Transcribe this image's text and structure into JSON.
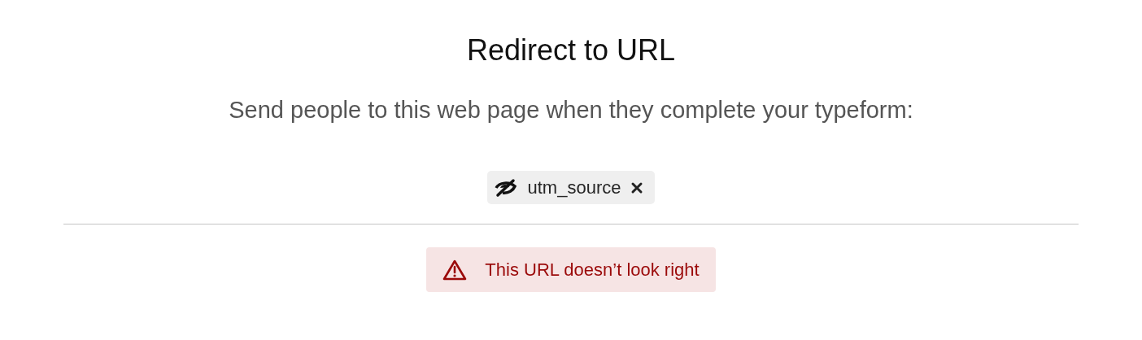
{
  "title": "Redirect to URL",
  "description": "Send people to this web page when they complete your typeform:",
  "url_variables": [
    {
      "label": "utm_source",
      "hidden": true
    }
  ],
  "error": {
    "message": "This URL doesn’t look right"
  }
}
